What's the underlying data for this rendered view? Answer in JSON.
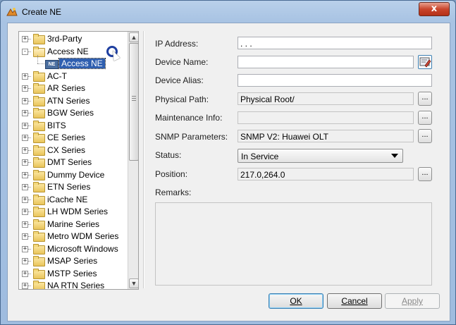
{
  "window": {
    "title": "Create NE",
    "close_glyph": "x"
  },
  "tree": {
    "items": [
      {
        "label": "3rd-Party",
        "expander": "+",
        "icon": "folder-icon"
      },
      {
        "label": "Access NE",
        "expander": "-",
        "icon": "folder-open-icon"
      },
      {
        "label": "Access NE",
        "expander": "",
        "icon": "ne-device-icon",
        "selected": true
      },
      {
        "label": "AC-T",
        "expander": "+",
        "icon": "folder-icon"
      },
      {
        "label": "AR Series",
        "expander": "+",
        "icon": "folder-icon"
      },
      {
        "label": "ATN Series",
        "expander": "+",
        "icon": "folder-icon"
      },
      {
        "label": "BGW Series",
        "expander": "+",
        "icon": "folder-icon"
      },
      {
        "label": "BITS",
        "expander": "+",
        "icon": "folder-icon"
      },
      {
        "label": "CE Series",
        "expander": "+",
        "icon": "folder-icon"
      },
      {
        "label": "CX Series",
        "expander": "+",
        "icon": "folder-icon"
      },
      {
        "label": "DMT Series",
        "expander": "+",
        "icon": "folder-icon"
      },
      {
        "label": "Dummy Device",
        "expander": "+",
        "icon": "folder-icon"
      },
      {
        "label": "ETN Series",
        "expander": "+",
        "icon": "folder-icon"
      },
      {
        "label": "iCache NE",
        "expander": "+",
        "icon": "folder-icon"
      },
      {
        "label": "LH WDM Series",
        "expander": "+",
        "icon": "folder-icon"
      },
      {
        "label": "Marine Series",
        "expander": "+",
        "icon": "folder-icon"
      },
      {
        "label": "Metro WDM Series",
        "expander": "+",
        "icon": "folder-icon"
      },
      {
        "label": "Microsoft Windows",
        "expander": "+",
        "icon": "folder-icon"
      },
      {
        "label": "MSAP Series",
        "expander": "+",
        "icon": "folder-icon"
      },
      {
        "label": "MSTP Series",
        "expander": "+",
        "icon": "folder-icon"
      },
      {
        "label": "NA RTN Series",
        "expander": "+",
        "icon": "folder-icon"
      }
    ],
    "ne_icon_text": "NE",
    "scroll_up": "▲",
    "scroll_down": "▼"
  },
  "form": {
    "ip_address": {
      "label": "IP Address:",
      "value": "   .    .    ."
    },
    "device_name": {
      "label": "Device Name:",
      "value": ""
    },
    "device_alias": {
      "label": "Device Alias:",
      "value": ""
    },
    "physical_path": {
      "label": "Physical Path:",
      "value": "Physical Root/"
    },
    "maintenance_info": {
      "label": "Maintenance Info:",
      "value": ""
    },
    "snmp_parameters": {
      "label": "SNMP Parameters:",
      "value": "SNMP V2: Huawei OLT"
    },
    "status": {
      "label": "Status:",
      "value": "In Service"
    },
    "position": {
      "label": "Position:",
      "value": "217.0,264.0"
    },
    "remarks": {
      "label": "Remarks:",
      "value": ""
    },
    "ellipsis_label": "..."
  },
  "buttons": {
    "ok": "OK",
    "cancel": "Cancel",
    "apply": "Apply"
  }
}
